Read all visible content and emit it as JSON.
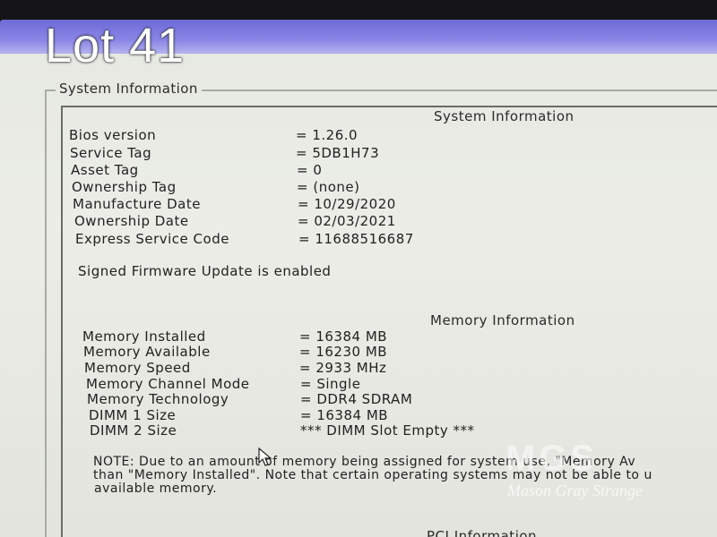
{
  "overlay": {
    "lot_label": "Lot 41"
  },
  "panel": {
    "legend": "System Information"
  },
  "system_info": {
    "heading": "System Information",
    "rows": [
      {
        "label": "Bios version",
        "value": "= 1.26.0"
      },
      {
        "label": "Service Tag",
        "value": "= 5DB1H73"
      },
      {
        "label": "Asset Tag",
        "value": "= 0"
      },
      {
        "label": "Ownership Tag",
        "value": "= (none)"
      },
      {
        "label": "Manufacture Date",
        "value": "= 10/29/2020"
      },
      {
        "label": "Ownership Date",
        "value": "= 02/03/2021"
      },
      {
        "label": "Express Service Code",
        "value": "= 11688516687"
      }
    ],
    "firmware_note": "Signed Firmware Update is enabled"
  },
  "memory_info": {
    "heading": "Memory Information",
    "rows": [
      {
        "label": "Memory Installed",
        "value": "= 16384 MB"
      },
      {
        "label": "Memory Available",
        "value": "= 16230 MB"
      },
      {
        "label": "Memory Speed",
        "value": "= 2933 MHz"
      },
      {
        "label": "Memory Channel Mode",
        "value": "= Single"
      },
      {
        "label": "Memory Technology",
        "value": "= DDR4 SDRAM"
      },
      {
        "label": "DIMM 1 Size",
        "value": "= 16384 MB"
      },
      {
        "label": "DIMM 2 Size",
        "value": "*** DIMM Slot Empty ***"
      }
    ],
    "note_lines": [
      "NOTE: Due to an amount of memory being assigned for system use, \"Memory Av",
      "than \"Memory Installed\". Note that certain operating systems may not be able to u",
      "available memory."
    ]
  },
  "pci_info": {
    "heading": "PCI Information"
  },
  "watermark": {
    "logo": "MGS",
    "text": "Mason Gray Strange"
  },
  "colors": {
    "title_bar": "#7c78e0",
    "screen_bg": "#e8e9e3",
    "text": "#222222"
  }
}
